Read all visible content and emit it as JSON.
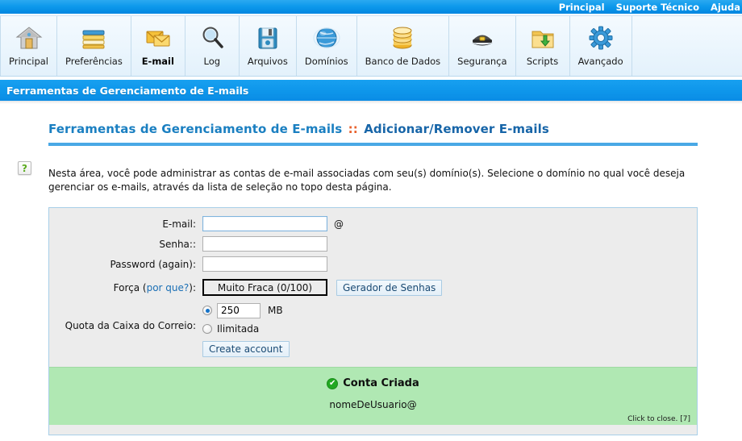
{
  "topbar": {
    "links": [
      {
        "label": "Principal",
        "name": "topnav-principal"
      },
      {
        "label": "Suporte Técnico",
        "name": "topnav-suporte-tecnico"
      },
      {
        "label": "Ajuda",
        "name": "topnav-ajuda"
      }
    ]
  },
  "toolbar": {
    "items": [
      {
        "label": "Principal",
        "icon": "house-icon",
        "active": false
      },
      {
        "label": "Preferências",
        "icon": "books-icon",
        "active": false
      },
      {
        "label": "E-mail",
        "icon": "envelope-icon",
        "active": true
      },
      {
        "label": "Log",
        "icon": "magnifier-icon",
        "active": false
      },
      {
        "label": "Arquivos",
        "icon": "floppy-disk-icon",
        "active": false
      },
      {
        "label": "Domínios",
        "icon": "globe-icon",
        "active": false
      },
      {
        "label": "Banco de Dados",
        "icon": "coins-icon",
        "active": false
      },
      {
        "label": "Segurança",
        "icon": "police-cap-icon",
        "active": false
      },
      {
        "label": "Scripts",
        "icon": "folder-download-icon",
        "active": false
      },
      {
        "label": "Avançado",
        "icon": "gear-icon",
        "active": false
      }
    ]
  },
  "section_banner": {
    "title": "Ferramentas de Gerenciamento de E-mails"
  },
  "breadcrumb": {
    "part1": "Ferramentas de Gerenciamento de E-mails",
    "separator": "::",
    "part2": "Adicionar/Remover E-mails"
  },
  "help": {
    "glyph": "?"
  },
  "description": "Nesta área, você pode administrar as contas de e-mail associadas com seu(s) domínio(s). Selecione o domínio no qual você deseja gerenciar os e-mails, através da lista de seleção no topo desta página.",
  "form": {
    "email": {
      "label": "E-mail:",
      "value": "",
      "placeholder": "",
      "suffix": "@"
    },
    "password": {
      "label": "Senha::",
      "value": "",
      "placeholder": ""
    },
    "password_again": {
      "label": "Password (again):",
      "value": "",
      "placeholder": ""
    },
    "strength": {
      "label_prefix": "Força (",
      "label_link": "por que?",
      "label_suffix": "):",
      "value": "Muito Fraca (0/100)",
      "generator_button": "Gerador de Senhas"
    },
    "quota": {
      "label": "Quota da Caixa do Correio:",
      "value": "250",
      "unit": "MB",
      "unlimited_label": "Ilimitada",
      "selected": "fixed"
    },
    "submit_button": "Create account"
  },
  "success": {
    "title": "Conta Criada",
    "check_glyph": "✔",
    "account": "nomeDeUsuario@",
    "close_hint": "Click to close. [7]"
  },
  "colors": {
    "brand_blue": "#0d95ea",
    "link_blue": "#1a7fc1",
    "accent_orange": "#e8602c",
    "success_green": "#b0e8b3",
    "panel_gray": "#ececec"
  }
}
